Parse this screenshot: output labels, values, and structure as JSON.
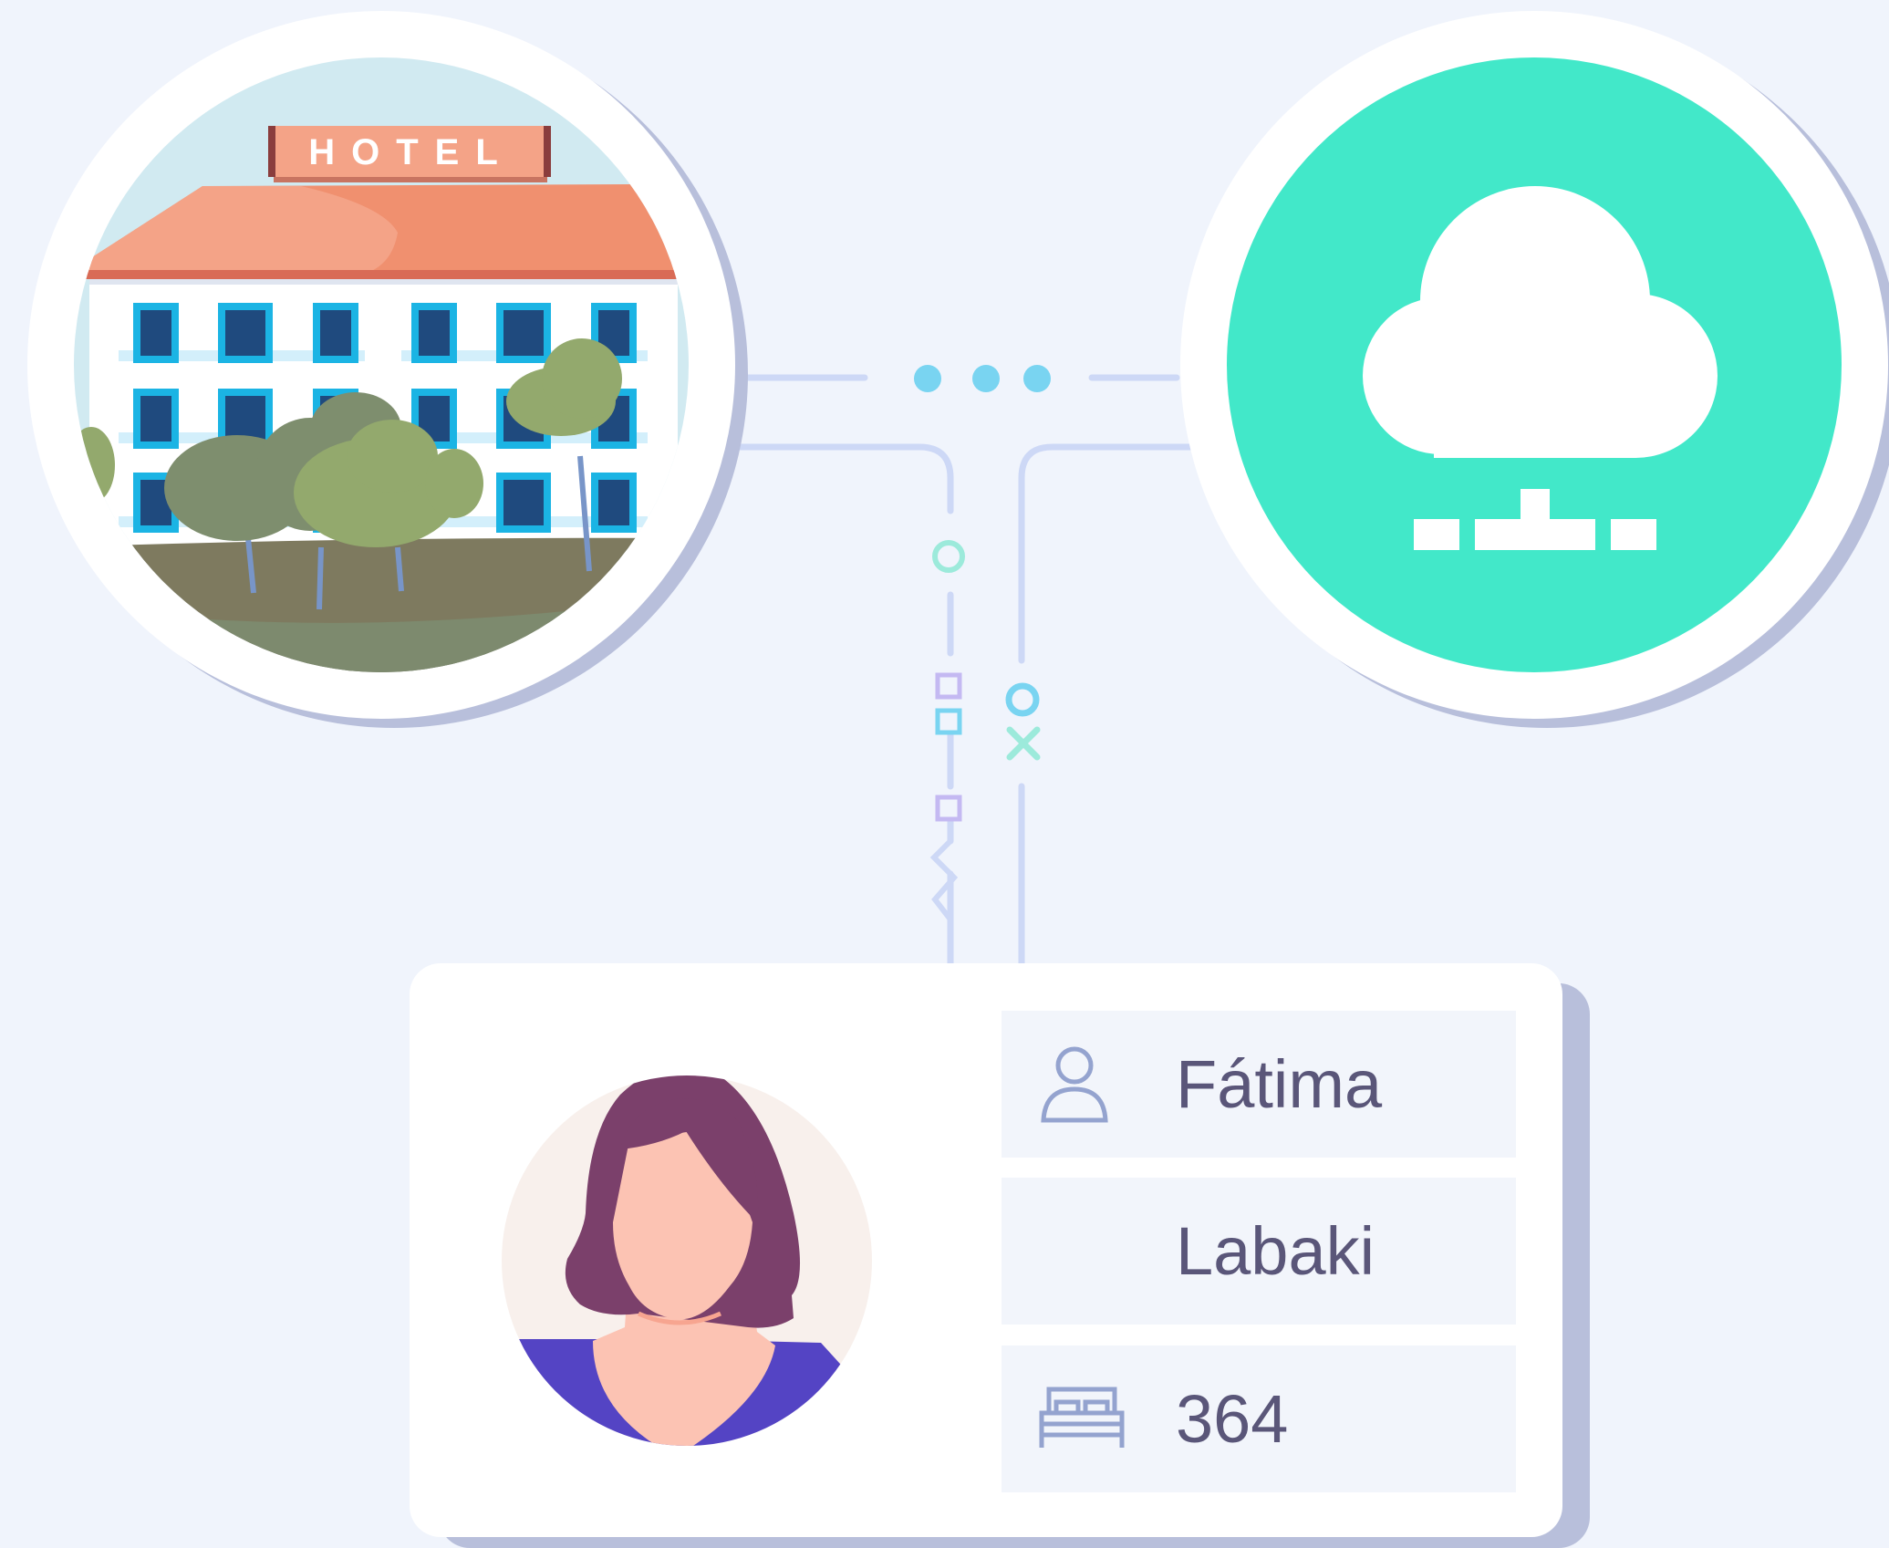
{
  "hotel": {
    "sign_text": "HOTEL"
  },
  "cloud": {
    "icon": "cloud-network-icon"
  },
  "connector": {
    "icons": [
      "dots-icon",
      "circle-icon",
      "square-icon",
      "cross-icon",
      "zigzag-icon"
    ]
  },
  "guest": {
    "avatar_icon": "woman-avatar",
    "first_name": "Fátima",
    "last_name": "Labaki",
    "room_number": "364",
    "first_name_icon": "user-icon",
    "room_icon": "bed-icon"
  },
  "colors": {
    "background": "#f0f4fc",
    "cloud_accent": "#42e8c9",
    "card_shadow": "#b8bfdb",
    "field_bg": "#f2f5fb",
    "text": "#5a5679",
    "hotel_roof": "#f0906f",
    "hair": "#7b406b",
    "shirt": "#5444c4"
  }
}
